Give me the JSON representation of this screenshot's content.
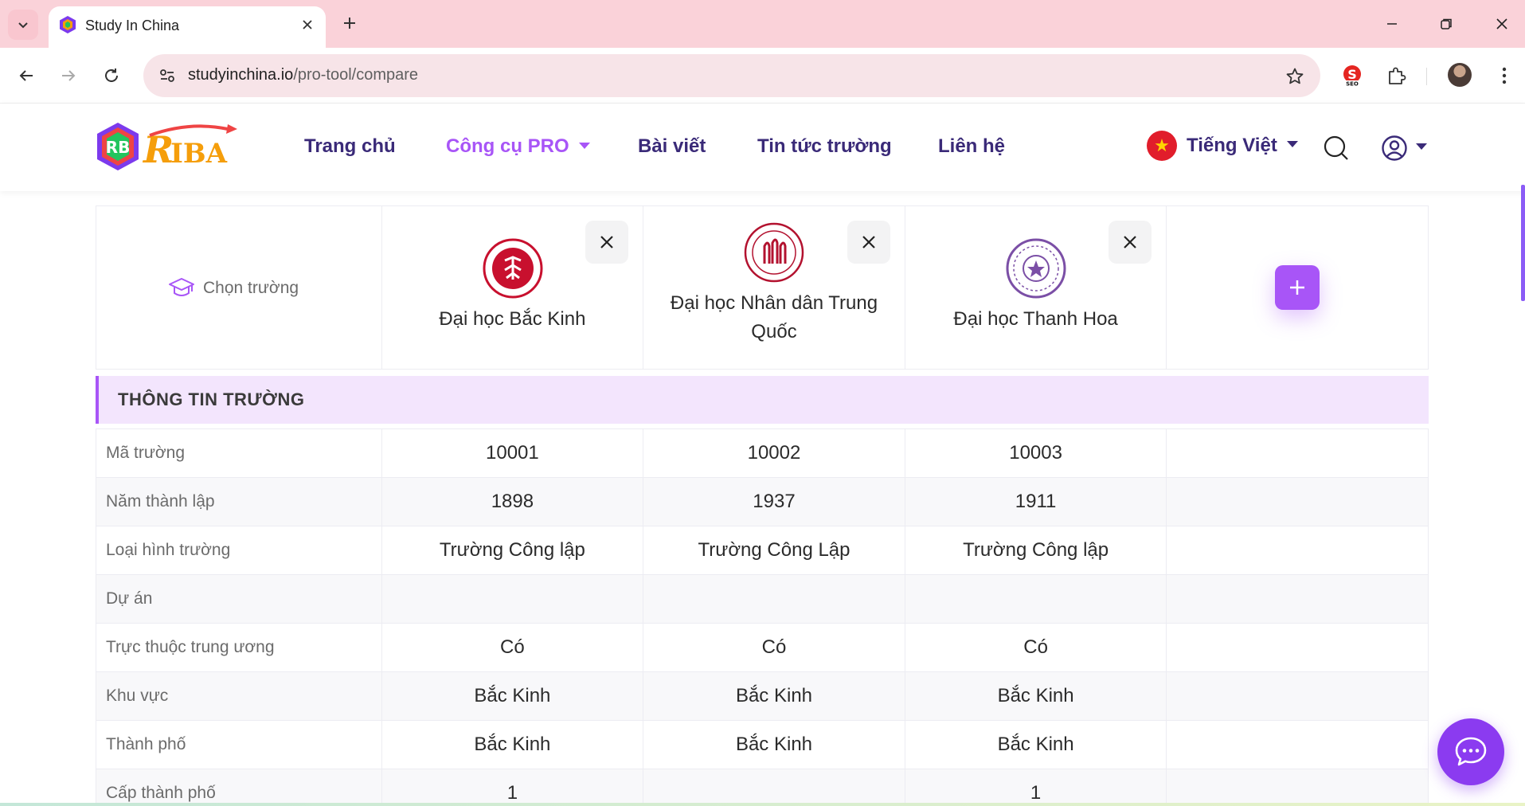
{
  "browser": {
    "tab_title": "Study In China",
    "url_host": "studyinchina.io",
    "url_path": "/pro-tool/compare"
  },
  "header": {
    "nav": [
      "Trang chủ",
      "Công cụ PRO",
      "Bài viết",
      "Tin tức trường",
      "Liên hệ"
    ],
    "active_nav": "Công cụ PRO",
    "language": "Tiếng Việt",
    "accent_color": "#a855f7",
    "nav_color": "#3a2a78"
  },
  "compare": {
    "choose_label": "Chọn trường",
    "schools": [
      {
        "name": "Đại học Bắc Kinh",
        "logo_color": "#c8102e"
      },
      {
        "name": "Đại học Nhân dân Trung Quốc",
        "logo_color": "#b3122f"
      },
      {
        "name": "Đại học Thanh Hoa",
        "logo_color": "#7b4fa6"
      }
    ],
    "section_title": "THÔNG TIN TRƯỜNG",
    "rows": [
      {
        "label": "Mã trường",
        "values": [
          "10001",
          "10002",
          "10003"
        ]
      },
      {
        "label": "Năm thành lập",
        "values": [
          "1898",
          "1937",
          "1911"
        ]
      },
      {
        "label": "Loại hình trường",
        "values": [
          "Trường Công lập",
          "Trường Công Lập",
          "Trường Công lập"
        ]
      },
      {
        "label": "Dự án",
        "values": [
          "",
          "",
          ""
        ]
      },
      {
        "label": "Trực thuộc trung ương",
        "values": [
          "Có",
          "Có",
          "Có"
        ]
      },
      {
        "label": "Khu vực",
        "values": [
          "Bắc Kinh",
          "Bắc Kinh",
          "Bắc Kinh"
        ]
      },
      {
        "label": "Thành phố",
        "values": [
          "Bắc Kinh",
          "Bắc Kinh",
          "Bắc Kinh"
        ]
      },
      {
        "label": "Cấp thành phố",
        "values": [
          "1",
          "",
          "1"
        ]
      }
    ]
  },
  "icons": {
    "chat": "chat-bubble-icon",
    "add": "plus-icon",
    "remove": "close-icon"
  }
}
